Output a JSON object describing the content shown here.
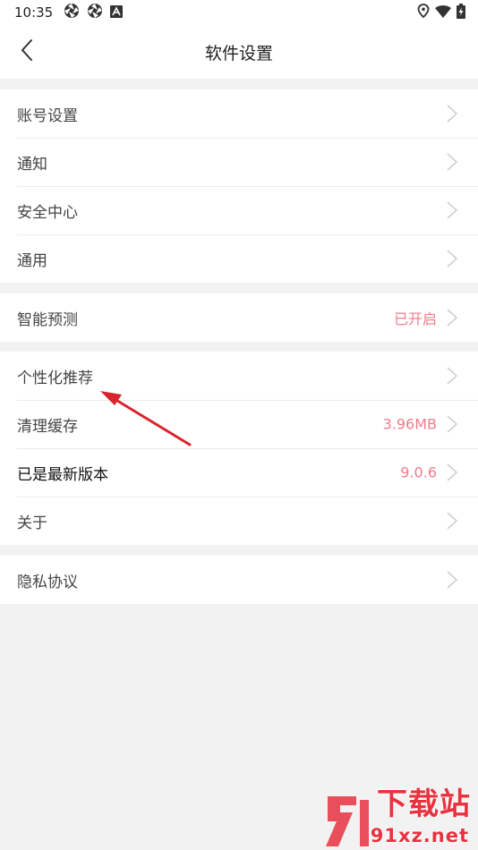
{
  "status_bar": {
    "time": "10:35",
    "icons_left": [
      "aperture-icon",
      "aperture-icon",
      "a-box-icon"
    ],
    "icons_right": [
      "location-icon",
      "wifi-icon",
      "battery-charging-icon"
    ]
  },
  "nav": {
    "title": "软件设置",
    "back_icon": "chevron-left-icon"
  },
  "groups": [
    {
      "items": [
        {
          "label": "账号设置",
          "value": ""
        },
        {
          "label": "通知",
          "value": ""
        },
        {
          "label": "安全中心",
          "value": ""
        },
        {
          "label": "通用",
          "value": ""
        }
      ]
    },
    {
      "items": [
        {
          "label": "智能预测",
          "value": "已开启"
        }
      ]
    },
    {
      "items": [
        {
          "label": "个性化推荐",
          "value": ""
        },
        {
          "label": "清理缓存",
          "value": "3.96MB"
        },
        {
          "label": "已是最新版本",
          "value": "9.0.6"
        },
        {
          "label": "关于",
          "value": ""
        }
      ]
    },
    {
      "items": [
        {
          "label": "隐私协议",
          "value": ""
        }
      ]
    }
  ],
  "colors": {
    "accent_value": "#f17b8c",
    "annotation_arrow": "#d9232e",
    "background": "#f2f2f2"
  },
  "watermark": {
    "line1": "下载站",
    "line2": "91xz.net"
  }
}
